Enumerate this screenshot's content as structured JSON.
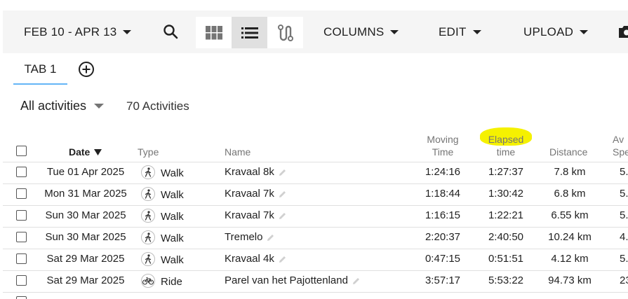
{
  "toolbar": {
    "date_range": "FEB 10 - APR 13",
    "columns_label": "COLUMNS",
    "edit_label": "EDIT",
    "upload_label": "UPLOAD"
  },
  "tabs": [
    {
      "label": "TAB 1"
    }
  ],
  "filter": {
    "label": "All activities",
    "count_text": "70 Activities"
  },
  "columns": {
    "date": "Date",
    "type": "Type",
    "name": "Name",
    "moving_time_1": "Moving",
    "moving_time_2": "Time",
    "elapsed_1": "Elapsed",
    "elapsed_2": "time",
    "distance": "Distance",
    "avg_1": "Av",
    "avg_2": "Spe"
  },
  "rows": [
    {
      "date": "Tue 01 Apr 2025",
      "type": "Walk",
      "name": "Kravaal 8k",
      "moving": "1:24:16",
      "elapsed": "1:27:37",
      "distance": "7.8 km",
      "avg": "5."
    },
    {
      "date": "Mon 31 Mar 2025",
      "type": "Walk",
      "name": "Kravaal 7k",
      "moving": "1:18:44",
      "elapsed": "1:30:42",
      "distance": "6.8 km",
      "avg": "5."
    },
    {
      "date": "Sun 30 Mar 2025",
      "type": "Walk",
      "name": "Kravaal 7k",
      "moving": "1:16:15",
      "elapsed": "1:22:21",
      "distance": "6.55 km",
      "avg": "5."
    },
    {
      "date": "Sun 30 Mar 2025",
      "type": "Walk",
      "name": "Tremelo",
      "moving": "2:20:37",
      "elapsed": "2:40:50",
      "distance": "10.24 km",
      "avg": "4."
    },
    {
      "date": "Sat 29 Mar 2025",
      "type": "Walk",
      "name": "Kravaal 4k",
      "moving": "0:47:15",
      "elapsed": "0:51:51",
      "distance": "4.12 km",
      "avg": "5."
    },
    {
      "date": "Sat 29 Mar 2025",
      "type": "Ride",
      "name": "Parel van het Pajottenland",
      "moving": "3:57:17",
      "elapsed": "5:53:22",
      "distance": "94.73 km",
      "avg": "23"
    }
  ],
  "icons": {
    "walk": "walk-icon",
    "ride": "bike-icon",
    "search": "search-icon",
    "grid": "grid-view-icon",
    "list": "list-view-icon",
    "route": "route-view-icon",
    "camera": "camera-icon",
    "add": "add-tab-icon",
    "edit": "pencil-icon",
    "sort": "sort-desc-icon"
  },
  "colors": {
    "highlight": "#f5f100",
    "tab_underline": "#64b5f6",
    "active_view": "#e0e0e0"
  }
}
